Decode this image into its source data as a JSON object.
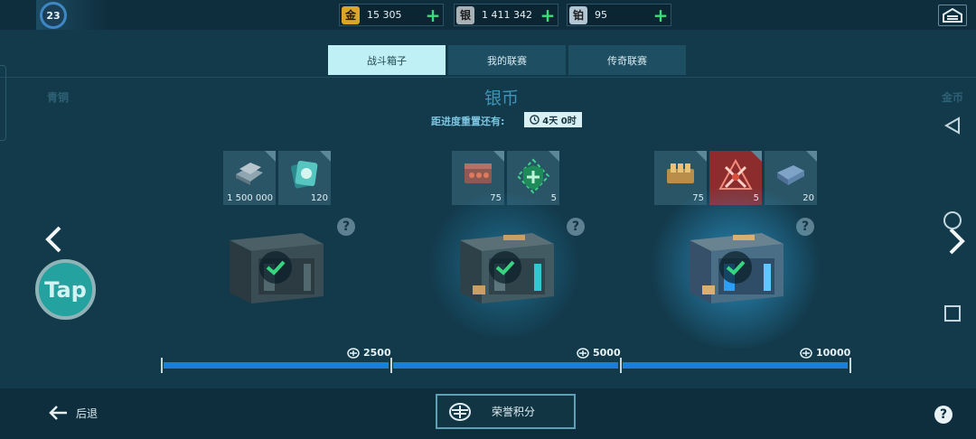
{
  "player": {
    "level": "23"
  },
  "currencies": [
    {
      "badge": "金",
      "value": "15 305",
      "color": "#d9a62a"
    },
    {
      "badge": "银",
      "value": "1 411 342",
      "color": "#a8b1b6"
    },
    {
      "badge": "铂",
      "value": "95",
      "color": "#b2c6d4"
    }
  ],
  "tabs": [
    {
      "label": "战斗箱子",
      "active": true
    },
    {
      "label": "我的联赛",
      "active": false
    },
    {
      "label": "传奇联赛",
      "active": false
    }
  ],
  "league": {
    "left": "青铜",
    "current": "银币",
    "right": "金币"
  },
  "reset": {
    "label": "距进度重置还有:",
    "timer": "4天 0时"
  },
  "boxes": [
    {
      "rewards": [
        {
          "amount": "1 500 000",
          "icon": "silver-coins-icon"
        },
        {
          "amount": "120",
          "icon": "card-pack-icon"
        }
      ],
      "points": "2500",
      "completed": true
    },
    {
      "rewards": [
        {
          "amount": "75",
          "icon": "ammo-case-icon"
        },
        {
          "amount": "5",
          "icon": "repair-kit-icon"
        }
      ],
      "points": "5000",
      "completed": true
    },
    {
      "rewards": [
        {
          "amount": "75",
          "icon": "gold-ammo-icon"
        },
        {
          "amount": "5",
          "icon": "crossed-swords-icon"
        },
        {
          "amount": "20",
          "icon": "blue-chip-icon"
        }
      ],
      "points": "10000",
      "completed": true
    }
  ],
  "progress": {
    "fill": 1.0
  },
  "bottom": {
    "back_label": "后退",
    "honor_label": "荣誉积分"
  },
  "colors": {
    "accent": "#1b7fd8",
    "check": "#36d680",
    "background": "#133a4b"
  }
}
